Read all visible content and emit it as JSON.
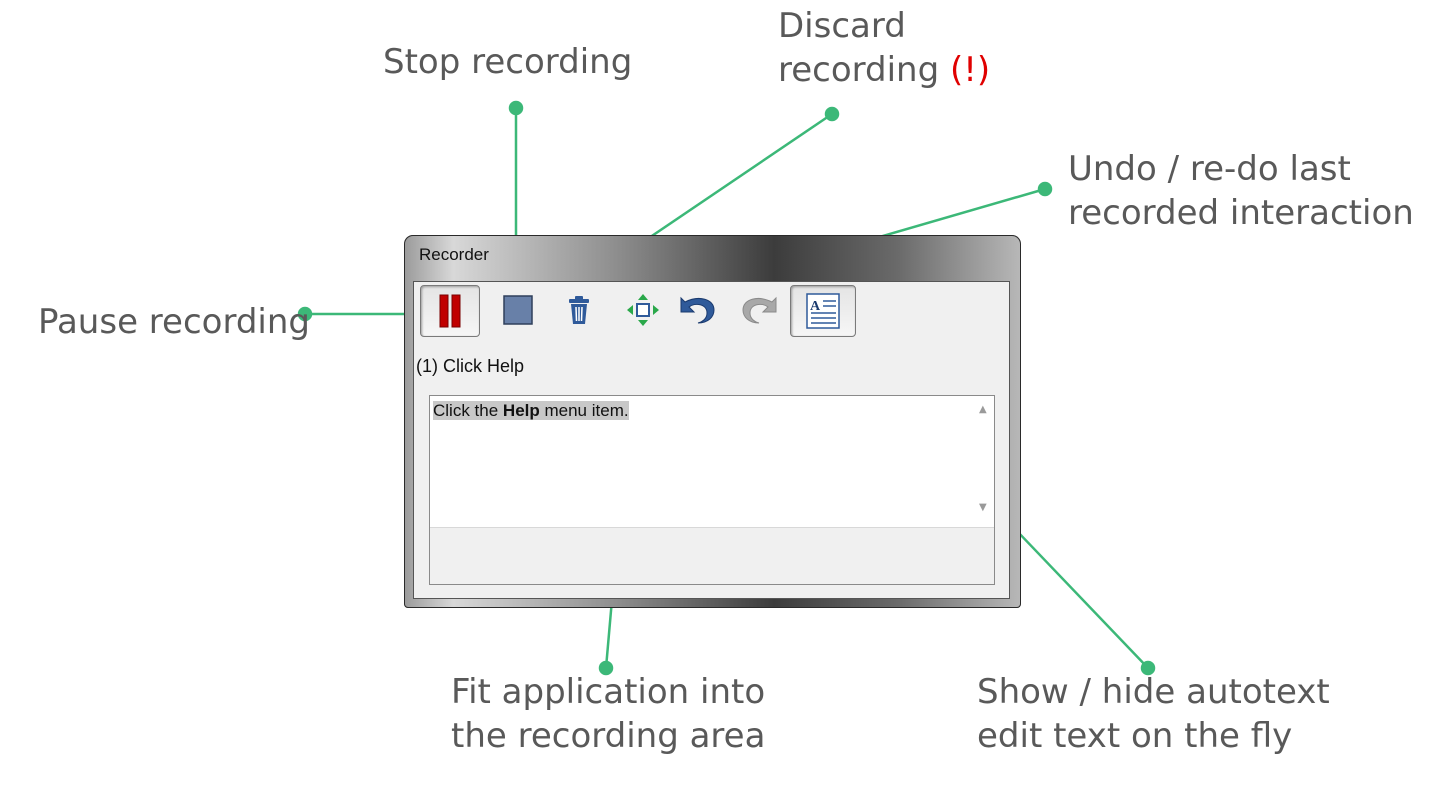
{
  "callouts": {
    "pause": [
      "Pause recording"
    ],
    "stop": [
      "Stop recording"
    ],
    "discard": [
      "Discard",
      "recording"
    ],
    "discard_warning": "(!)",
    "undo": [
      "Undo / re-do last",
      "recorded interaction"
    ],
    "fit": [
      "Fit application into",
      "the recording area"
    ],
    "show": [
      "Show / hide autotext",
      "edit text on the fly"
    ]
  },
  "window": {
    "title": "Recorder",
    "step_label": "(1) Click Help",
    "text": {
      "before": "Click the ",
      "bold": "Help",
      "after": " menu item."
    }
  },
  "icons": {
    "pause": "pause-icon",
    "stop": "stop-icon",
    "discard": "trash-icon",
    "fit": "fit-arrows-icon",
    "undo": "undo-icon",
    "redo": "redo-icon",
    "autotext": "autotext-icon"
  },
  "colors": {
    "callout": "#3cb878",
    "label": "#595959",
    "warning": "#e00000",
    "pause": "#c00000",
    "stop": "#6880a8",
    "icon_blue": "#2f5a9a"
  }
}
